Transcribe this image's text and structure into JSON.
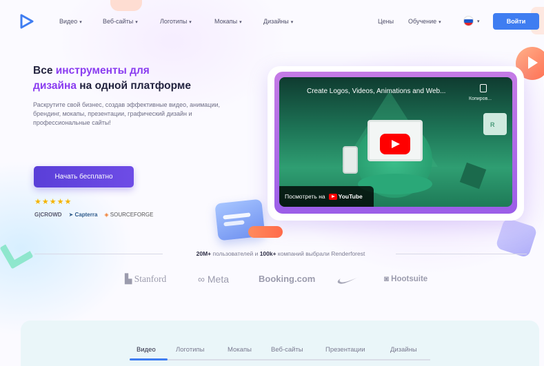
{
  "nav": {
    "logo": "play-logo-icon",
    "items": [
      {
        "label": "Видео",
        "caret": "▾"
      },
      {
        "label": "Веб-сайты",
        "caret": "▾"
      },
      {
        "label": "Логотипы",
        "caret": "▾"
      },
      {
        "label": "Мокапы",
        "caret": "▾"
      },
      {
        "label": "Дизайны",
        "caret": "▾"
      }
    ],
    "pricing": "Цены",
    "learning": {
      "label": "Обучение",
      "caret": "▾"
    },
    "language_caret": "▾",
    "login": "Войти"
  },
  "hero": {
    "title_part1": "Все ",
    "title_accent1": "инструменты для",
    "title_accent2": "дизайна",
    "title_part2": " на одной платформе",
    "subtitle": "Раскрутите свой бизнес, создав эффективные видео, анимации, брендинг, мокапы, презентации, графический дизайн и профессиональные сайты!",
    "cta": "Начать бесплатно",
    "stars": "★★★★★",
    "review_sites": [
      {
        "label": "G|CROWD"
      },
      {
        "label": "Capterra"
      },
      {
        "label": "SOURCEFORGE"
      }
    ]
  },
  "video": {
    "title": "Create Logos, Videos, Animations and Web...",
    "copy_label": "Копиров...",
    "watch_on": "Посмотреть на",
    "youtube": "YouTube"
  },
  "proof": {
    "users_count": "20M+",
    "users_text": " пользователей и ",
    "companies_count": "100k+",
    "companies_text": " компаний выбрали Renderforest"
  },
  "brands": [
    "Stanford",
    "Meta",
    "Booking.com",
    "Hootsuite"
  ],
  "tabs": {
    "items": [
      "Видео",
      "Логотипы",
      "Мокапы",
      "Веб-сайты",
      "Презентации",
      "Дизайны"
    ],
    "active_index": 0
  },
  "colors": {
    "primary": "#3f7df1",
    "accent": "#8a3cf0",
    "cta": "#5a3fd8",
    "youtube_red": "#ff0000"
  }
}
